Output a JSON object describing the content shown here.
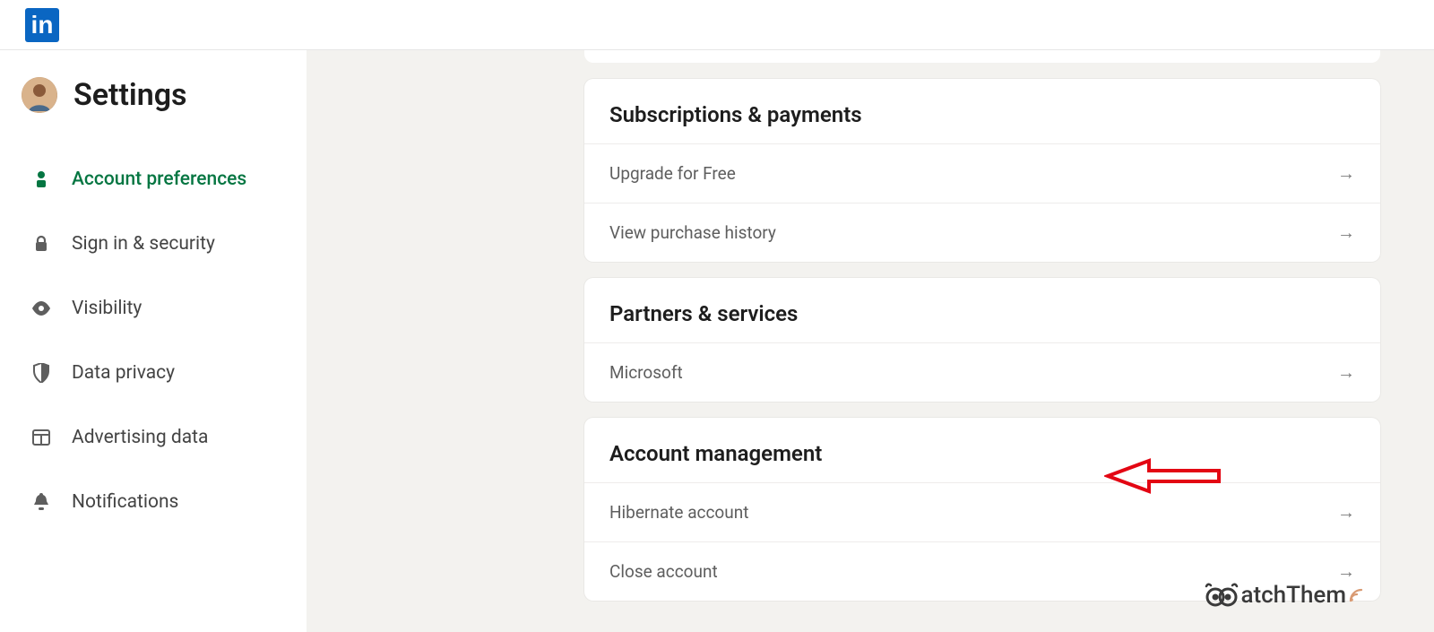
{
  "logo_text": "in",
  "page_title": "Settings",
  "sidebar": {
    "items": [
      {
        "label": "Account preferences",
        "active": true
      },
      {
        "label": "Sign in & security",
        "active": false
      },
      {
        "label": "Visibility",
        "active": false
      },
      {
        "label": "Data privacy",
        "active": false
      },
      {
        "label": "Advertising data",
        "active": false
      },
      {
        "label": "Notifications",
        "active": false
      }
    ]
  },
  "sections": [
    {
      "title": "Subscriptions & payments",
      "rows": [
        "Upgrade for Free",
        "View purchase history"
      ]
    },
    {
      "title": "Partners & services",
      "rows": [
        "Microsoft"
      ]
    },
    {
      "title": "Account management",
      "rows": [
        "Hibernate account",
        "Close account"
      ]
    }
  ],
  "watermark_text": "atchThem"
}
